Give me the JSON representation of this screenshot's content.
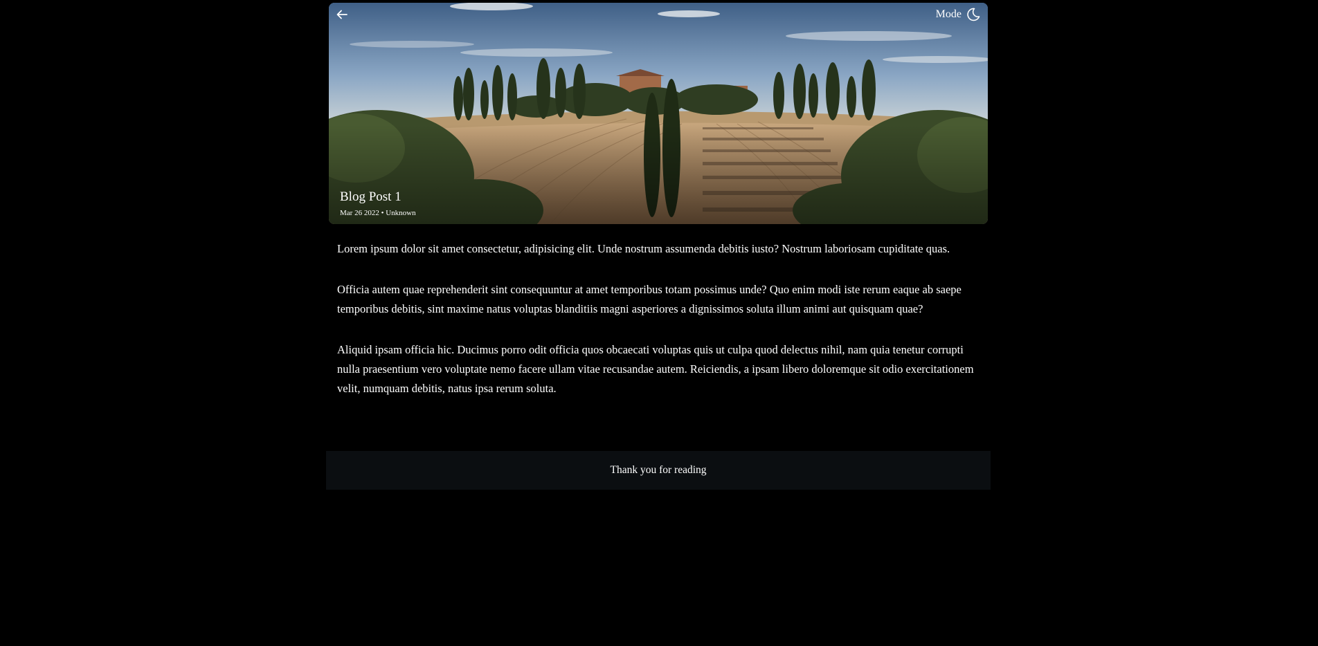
{
  "header": {
    "back_icon": "arrow-left-icon",
    "mode_label": "Mode",
    "mode_icon": "moon-icon"
  },
  "hero": {
    "image": "tuscany-landscape-photo",
    "title": "Blog Post 1",
    "date": "Mar 26 2022",
    "separator": "•",
    "author": "Unknown"
  },
  "article": {
    "paragraphs": [
      "Lorem ipsum dolor sit amet consectetur, adipisicing elit. Unde nostrum assumenda debitis iusto? Nostrum laboriosam cupiditate quas.",
      "Officia autem quae reprehenderit sint consequuntur at amet temporibus totam possimus unde? Quo enim modi iste rerum eaque ab saepe temporibus debitis, sint maxime natus voluptas blanditiis magni asperiores a dignissimos soluta illum animi aut quisquam quae?",
      "Aliquid ipsam officia hic. Ducimus porro odit officia quos obcaecati voluptas quis ut culpa quod delectus nihil, nam quia tenetur corrupti nulla praesentium vero voluptate nemo facere ullam vitae recusandae autem. Reiciendis, a ipsam libero doloremque sit odio exercitationem velit, numquam debitis, natus ipsa rerum soluta."
    ]
  },
  "footer": {
    "text": "Thank you for reading"
  },
  "colors": {
    "background": "#000000",
    "footer_bg": "#0b0e11",
    "text": "#ffffff"
  }
}
